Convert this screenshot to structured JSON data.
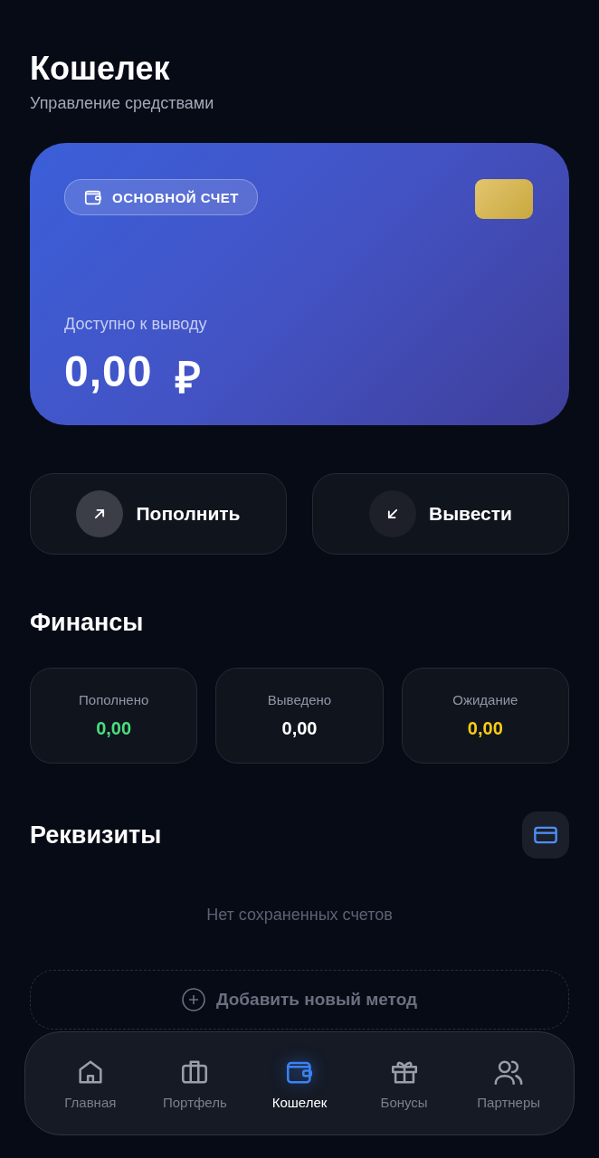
{
  "header": {
    "title": "Кошелек",
    "subtitle": "Управление средствами"
  },
  "card": {
    "badge": "ОСНОВНОЙ СЧЕТ",
    "label": "Доступно к выводу",
    "amount": "0,00",
    "currency": "₽"
  },
  "actions": [
    {
      "label": "Пополнить",
      "kind": "deposit"
    },
    {
      "label": "Вывести",
      "kind": "withdraw"
    }
  ],
  "finances": {
    "title": "Финансы",
    "stats": [
      {
        "label": "Пополнено",
        "value": "0,00",
        "color": "#4ade80"
      },
      {
        "label": "Выведено",
        "value": "0,00",
        "color": "#ffffff"
      },
      {
        "label": "Ожидание",
        "value": "0,00",
        "color": "#facc15"
      }
    ]
  },
  "requisites": {
    "title": "Реквизиты",
    "empty_text": "Нет сохраненных счетов",
    "add_button": "Добавить новый метод"
  },
  "nav": [
    {
      "label": "Главная",
      "kind": "home",
      "selected": false
    },
    {
      "label": "Портфель",
      "kind": "portfolio",
      "selected": false
    },
    {
      "label": "Кошелек",
      "kind": "wallet",
      "selected": true
    },
    {
      "label": "Бонусы",
      "kind": "bonus",
      "selected": false
    },
    {
      "label": "Партнеры",
      "kind": "partners",
      "selected": false
    }
  ]
}
